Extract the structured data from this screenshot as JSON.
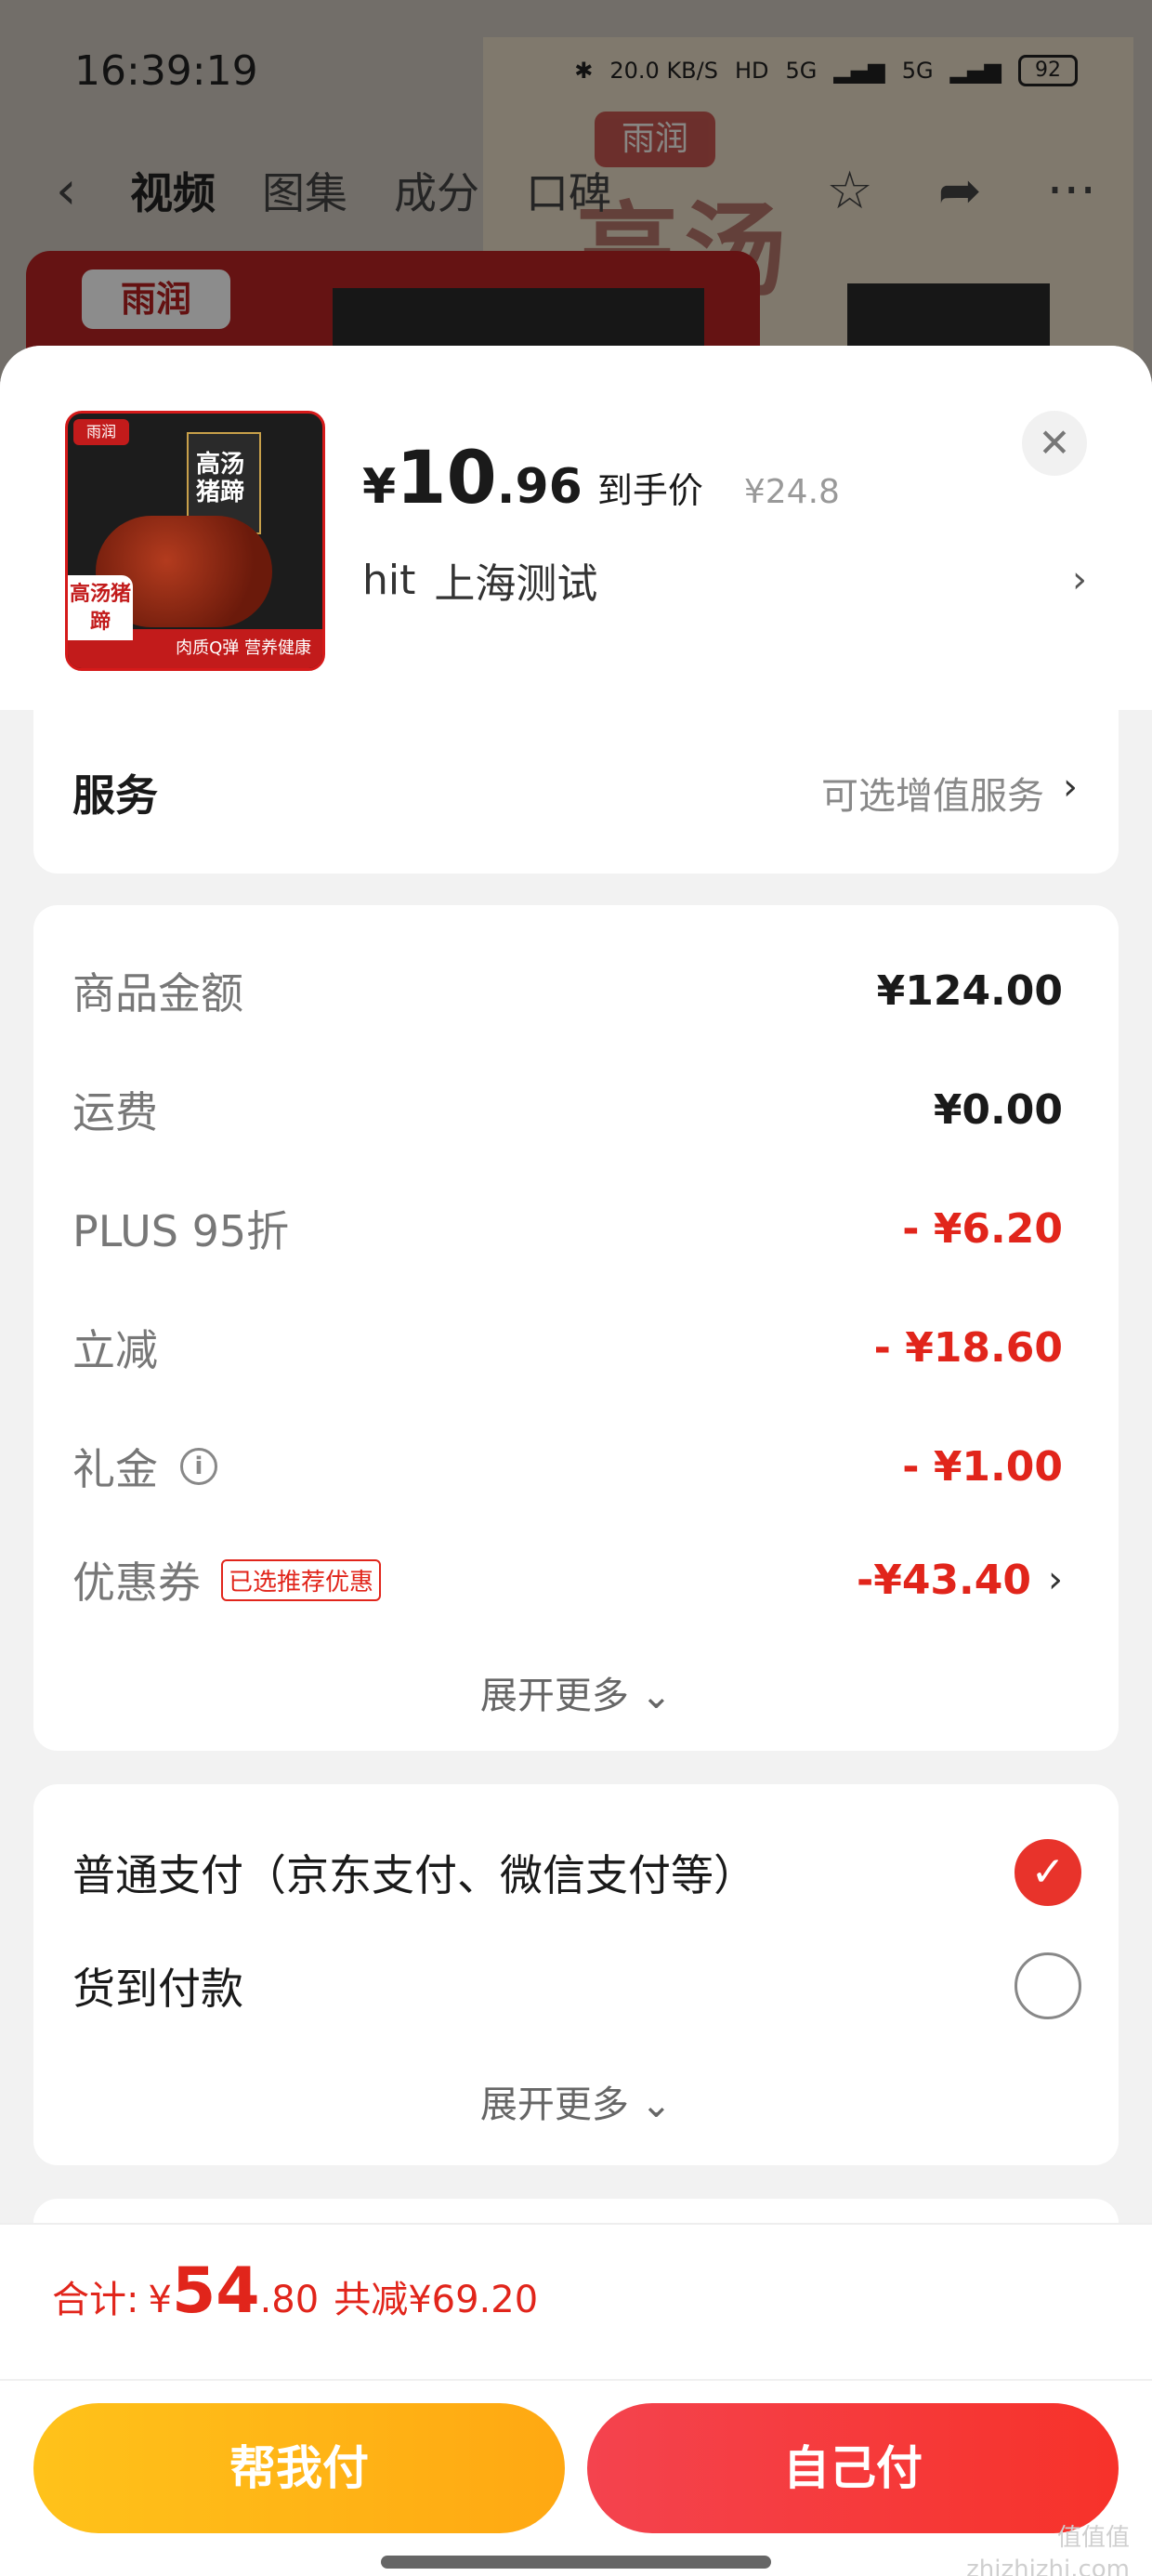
{
  "status_bar": {
    "time": "16:39:19",
    "network_speed": "20.0 KB/S",
    "hd_label": "HD",
    "signal1": "5G",
    "signal2": "5G",
    "battery": "92"
  },
  "top_nav": {
    "tabs": [
      "视频",
      "图集",
      "成分",
      "口碑"
    ],
    "active_tab": "视频"
  },
  "background": {
    "hero_logo": "雨润",
    "hero_text": "高汤",
    "card_logo": "雨润"
  },
  "product": {
    "thumb_logo": "雨润",
    "thumb_title": "高汤猪蹄",
    "thumb_badge": "高汤猪蹄",
    "thumb_tagline": "肉质Q弹 营养健康",
    "price_currency": "¥",
    "price_int": "10",
    "price_dec": ".96",
    "price_tag": "到手价",
    "original_price": "¥24.8",
    "address_name": "hit",
    "address_city": "上海测试"
  },
  "service": {
    "label": "服务",
    "value": "可选增值服务"
  },
  "amounts": {
    "rows": [
      {
        "label": "商品金额",
        "value": "¥124.00"
      },
      {
        "label": "运费",
        "value": "¥0.00"
      },
      {
        "label": "PLUS 95折",
        "value": "- ¥6.20"
      },
      {
        "label": "立减",
        "value": "- ¥18.60"
      },
      {
        "label": "礼金",
        "value": "- ¥1.00"
      },
      {
        "label": "优惠券",
        "value": "-¥43.40"
      }
    ],
    "coupon_badge": "已选推荐优惠",
    "expand_label": "展开更多"
  },
  "payment": {
    "options": [
      {
        "label": "普通支付（京东支付、微信支付等）",
        "checked": true
      },
      {
        "label": "货到付款",
        "checked": false
      }
    ],
    "expand_label": "展开更多"
  },
  "bottom": {
    "total_label": "合计:",
    "total_currency": "¥",
    "total_int": "54",
    "total_dec": ".80",
    "saved_text": "共减¥69.20",
    "help_pay_label": "帮我付",
    "self_pay_label": "自己付",
    "watermark_line1": "值值值",
    "watermark_line2": "zhizhizhi.com"
  },
  "colors": {
    "accent_red": "#e1251b",
    "help_button": "#ffb516",
    "self_button": "#f5383a"
  }
}
